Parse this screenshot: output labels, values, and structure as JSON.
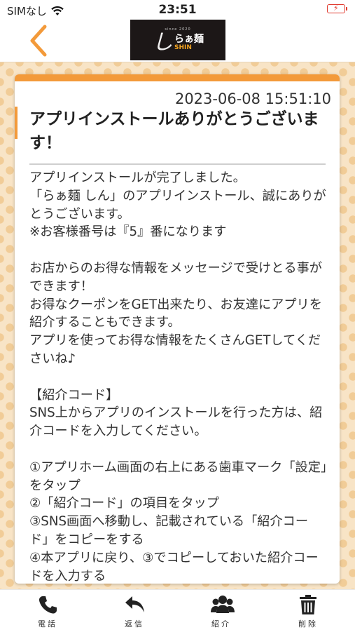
{
  "status_bar": {
    "carrier": "SIMなし",
    "time": "23:51"
  },
  "header": {
    "logo_text": "らぁ麺",
    "logo_brand": "SHIN",
    "logo_small": "since 2020"
  },
  "message": {
    "datetime": "2023-06-08 15:51:10",
    "title": "アプリインストールありがとうございます！",
    "body": "アプリインストールが完了しました。\n「らぁ麺 しん」のアプリインストール、誠にありがとうございます。\n※お客様番号は『5』番になります\n\nお店からのお得な情報をメッセージで受けとる事ができます！\nお得なクーポンをGET出来たり、お友達にアプリを紹介することもできます。\nアプリを使ってお得な情報をたくさんGETしてくださいね♪\n\n【紹介コード】\nSNS上からアプリのインストールを行った方は、紹介コードを入力してください。\n\n①アプリホーム画面の右上にある歯車マーク「設定」をタップ\n②「紹介コード」の項目をタップ\n③SNS画面へ移動し、記載されている「紹介コード」をコピーをする\n④本アプリに戻り、③でコピーしておいた紹介コードを入力する"
  },
  "bottom_nav": [
    {
      "label": "電話",
      "icon": "phone-icon"
    },
    {
      "label": "返信",
      "icon": "reply-icon"
    },
    {
      "label": "紹介",
      "icon": "users-icon"
    },
    {
      "label": "削除",
      "icon": "trash-icon"
    }
  ],
  "colors": {
    "accent": "#f39a3a",
    "background_pattern": "#f8e4c6",
    "battery": "#e03a2e"
  }
}
